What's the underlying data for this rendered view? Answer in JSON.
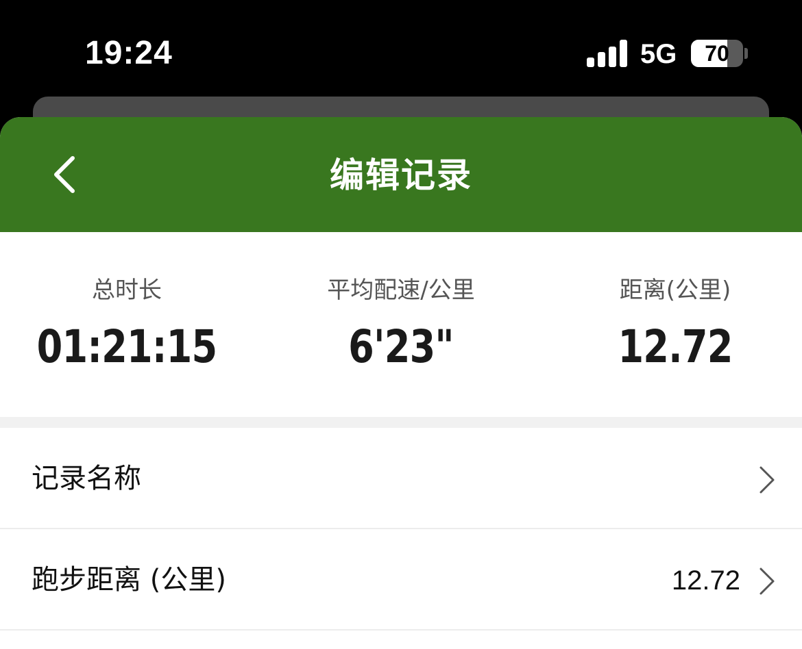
{
  "status_bar": {
    "time": "19:24",
    "network": "5G",
    "battery_level": "70",
    "battery_fraction": 0.7,
    "signal_bars": 4
  },
  "nav": {
    "title": "编辑记录",
    "back_icon": "chevron-left-icon"
  },
  "stats": [
    {
      "label": "总时长",
      "value": "01:21:15"
    },
    {
      "label": "平均配速/公里",
      "value": "6'23\""
    },
    {
      "label": "距离(公里)",
      "value": "12.72"
    }
  ],
  "rows": [
    {
      "label": "记录名称",
      "value": ""
    },
    {
      "label": "跑步距离 (公里)",
      "value": "12.72"
    }
  ],
  "colors": {
    "accent": "#39771f",
    "background": "#ffffff",
    "status_bar": "#000000"
  }
}
